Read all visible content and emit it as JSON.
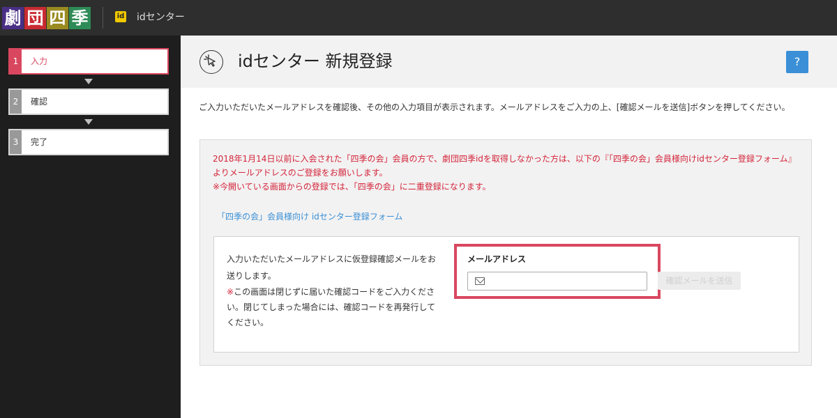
{
  "header": {
    "logo": [
      "劇",
      "団",
      "四",
      "季"
    ],
    "logo_colors": [
      "#4a2f86",
      "#c92b32",
      "#9a8b21",
      "#2e8b57"
    ],
    "id_badge": "id",
    "title": "idセンター"
  },
  "steps": [
    {
      "num": "1",
      "label": "入力",
      "active": true
    },
    {
      "num": "2",
      "label": "確認",
      "active": false
    },
    {
      "num": "3",
      "label": "完了",
      "active": false
    }
  ],
  "page": {
    "title": "idセンター 新規登録",
    "help_label": "?",
    "intro": "ご入力いただいたメールアドレスを確認後、その他の入力項目が表示されます。メールアドレスをご入力の上、[確認メールを送信]ボタンを押してください。"
  },
  "notice": {
    "line1": "2018年1月14日以前に入会された「四季の会」会員の方で、劇団四季idを取得しなかった方は、以下の『「四季の会」会員様向けidセンター登録フォーム』よりメールアドレスのご登録をお願いします。",
    "line2": "※今開いている画面からの登録では、「四季の会」に二重登録になります。",
    "link": "「四季の会」会員様向け idセンター登録フォーム"
  },
  "form": {
    "desc": "入力いただいたメールアドレスに仮登録確認メールをお送りします。",
    "note_mark": "※",
    "note": "この画面は閉じずに届いた確認コードをご入力ください。閉じてしまった場合には、確認コードを再発行してください。",
    "email_label": "メールアドレス",
    "email_value": "",
    "email_placeholder": "",
    "send_label": "確認メールを送信"
  },
  "colors": {
    "accent": "#d9475f",
    "link": "#3a8fd6",
    "notice": "#d4243a",
    "header_bg": "#2e2e2e",
    "sidebar_bg": "#1e1e1e"
  }
}
